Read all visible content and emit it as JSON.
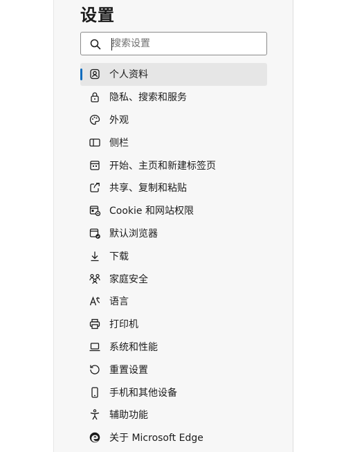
{
  "settings": {
    "title": "设置",
    "search": {
      "placeholder": "搜索设置",
      "value": ""
    },
    "nav": [
      {
        "label": "个人资料",
        "icon": "profile-icon",
        "active": true
      },
      {
        "label": "隐私、搜索和服务",
        "icon": "lock-icon"
      },
      {
        "label": "外观",
        "icon": "palette-icon"
      },
      {
        "label": "侧栏",
        "icon": "sidebar-icon"
      },
      {
        "label": "开始、主页和新建标签页",
        "icon": "home-tab-icon"
      },
      {
        "label": "共享、复制和粘贴",
        "icon": "share-icon"
      },
      {
        "label": "Cookie 和网站权限",
        "icon": "site-permissions-icon"
      },
      {
        "label": "默认浏览器",
        "icon": "default-browser-icon"
      },
      {
        "label": "下载",
        "icon": "download-icon"
      },
      {
        "label": "家庭安全",
        "icon": "family-icon"
      },
      {
        "label": "语言",
        "icon": "language-icon"
      },
      {
        "label": "打印机",
        "icon": "printer-icon"
      },
      {
        "label": "系统和性能",
        "icon": "laptop-icon"
      },
      {
        "label": "重置设置",
        "icon": "reset-icon"
      },
      {
        "label": "手机和其他设备",
        "icon": "phone-icon"
      },
      {
        "label": "辅助功能",
        "icon": "accessibility-icon"
      },
      {
        "label": "关于 Microsoft Edge",
        "icon": "edge-logo-icon"
      }
    ]
  },
  "colors": {
    "accent": "#0f6cbd",
    "active_bg": "#e6e6e6",
    "panel_bg": "#f7f7f7"
  }
}
